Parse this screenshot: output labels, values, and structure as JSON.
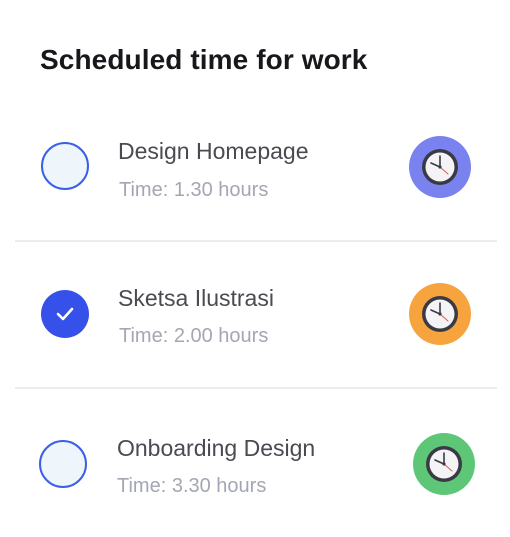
{
  "header": {
    "title": "Scheduled time for work"
  },
  "tasks": [
    {
      "title": "Design Homepage",
      "time": "Time: 1.30 hours",
      "checked": false,
      "clock_color": "#7a82f0",
      "icon": "clock-icon"
    },
    {
      "title": "Sketsa Ilustrasi",
      "time": "Time: 2.00 hours",
      "checked": true,
      "clock_color": "#f7a33e",
      "icon": "clock-icon"
    },
    {
      "title": "Onboarding Design",
      "time": "Time: 3.30 hours",
      "checked": false,
      "clock_color": "#5dc777",
      "icon": "clock-icon"
    }
  ],
  "colors": {
    "accent": "#3650ea",
    "checkbox_fill": "#eef5fb",
    "divider": "#ececef"
  }
}
